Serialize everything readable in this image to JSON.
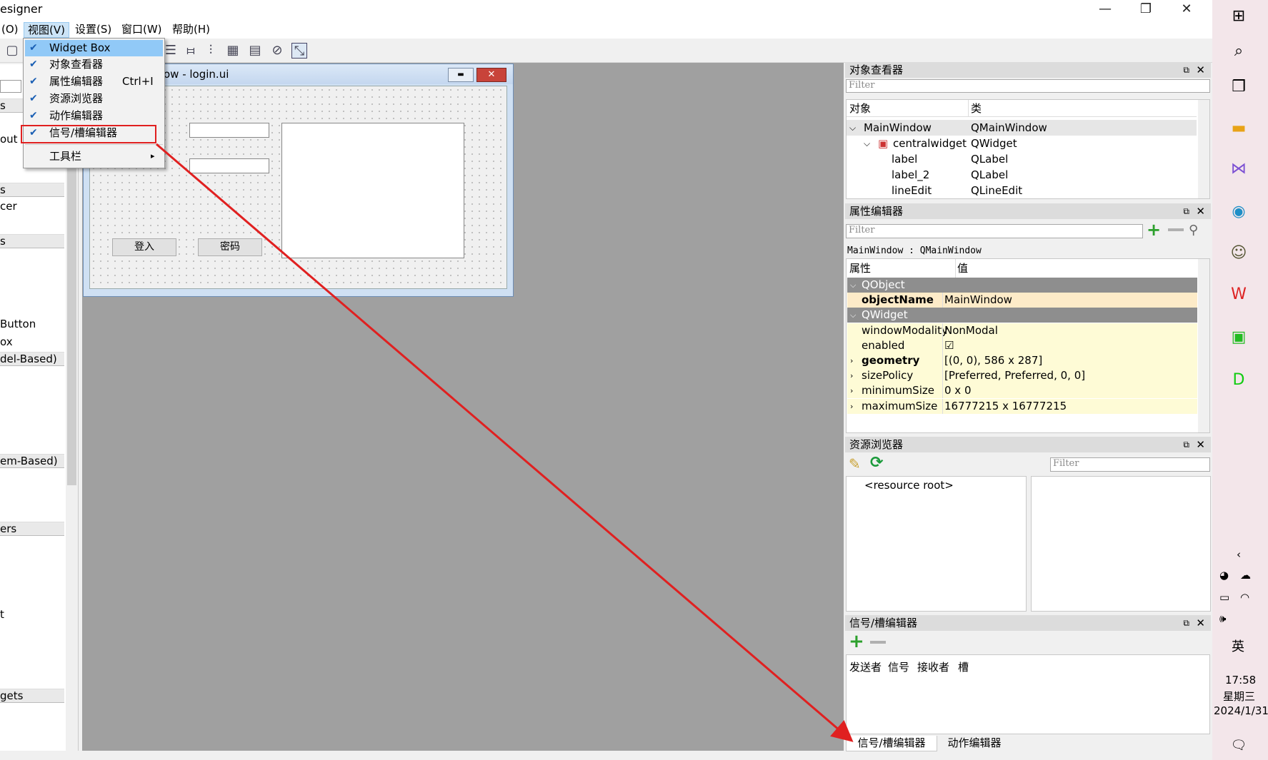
{
  "window": {
    "title": "esigner",
    "min": "—",
    "max": "❐",
    "close": "✕"
  },
  "menubar": {
    "items": [
      "(O)",
      "视图(V)",
      "设置(S)",
      "窗口(W)",
      "帮助(H)"
    ]
  },
  "view_menu": {
    "items": [
      {
        "label": "Widget Box",
        "checked": true,
        "shortcut": ""
      },
      {
        "label": "对象查看器",
        "checked": true,
        "shortcut": ""
      },
      {
        "label": "属性编辑器",
        "checked": true,
        "shortcut": "Ctrl+I"
      },
      {
        "label": "资源浏览器",
        "checked": true,
        "shortcut": ""
      },
      {
        "label": "动作编辑器",
        "checked": true,
        "shortcut": ""
      },
      {
        "label": "信号/槽编辑器",
        "checked": true,
        "shortcut": ""
      },
      {
        "label": "工具栏",
        "checked": false,
        "shortcut": "▸"
      }
    ]
  },
  "left_pane": {
    "headers": [
      "s",
      "s",
      "s",
      "ers",
      "gets"
    ],
    "items": [
      "out",
      "cer",
      "Button",
      "ox",
      "del-Based)",
      "em-Based)",
      "t"
    ]
  },
  "form_window": {
    "title": "ow - login.ui",
    "button1": "登入",
    "button2": "密码",
    "min": "▬",
    "close": "✕"
  },
  "object_inspector": {
    "title": "对象查看器",
    "filter_placeholder": "Filter",
    "col_object": "对象",
    "col_class": "类",
    "rows": [
      {
        "object": "MainWindow",
        "class": "QMainWindow"
      },
      {
        "object": "centralwidget",
        "class": "QWidget"
      },
      {
        "object": "label",
        "class": "QLabel"
      },
      {
        "object": "label_2",
        "class": "QLabel"
      },
      {
        "object": "lineEdit",
        "class": "QLineEdit"
      }
    ]
  },
  "property_editor": {
    "title": "属性编辑器",
    "filter_placeholder": "Filter",
    "context": "MainWindow : QMainWindow",
    "col_property": "属性",
    "col_value": "值",
    "rows": [
      {
        "name": "QObject",
        "value": "",
        "kind": "section"
      },
      {
        "name": "objectName",
        "value": "MainWindow",
        "kind": "orange"
      },
      {
        "name": "QWidget",
        "value": "",
        "kind": "section"
      },
      {
        "name": "windowModality",
        "value": "NonModal",
        "kind": "yellow"
      },
      {
        "name": "enabled",
        "value": "☑",
        "kind": "yellow"
      },
      {
        "name": "geometry",
        "value": "[(0, 0), 586 x 287]",
        "kind": "yellow-bold"
      },
      {
        "name": "sizePolicy",
        "value": "[Preferred, Preferred, 0, 0]",
        "kind": "yellow"
      },
      {
        "name": "minimumSize",
        "value": "0 x 0",
        "kind": "yellow"
      },
      {
        "name": "maximumSize",
        "value": "16777215 x 16777215",
        "kind": "yellow"
      }
    ]
  },
  "resource_browser": {
    "title": "资源浏览器",
    "filter_placeholder": "Filter",
    "root": "<resource root>"
  },
  "signal_slot_editor": {
    "title": "信号/槽编辑器",
    "cols": [
      "发送者",
      "信号",
      "接收者",
      "槽"
    ]
  },
  "bottom_tabs": [
    "信号/槽编辑器",
    "动作编辑器"
  ],
  "taskbar": {
    "ime": "英",
    "time": "17:58",
    "weekday": "星期三",
    "date": "2024/1/31"
  },
  "colors": {
    "annotation_red": "#e02020",
    "accent_blue": "#1a5fb4"
  }
}
